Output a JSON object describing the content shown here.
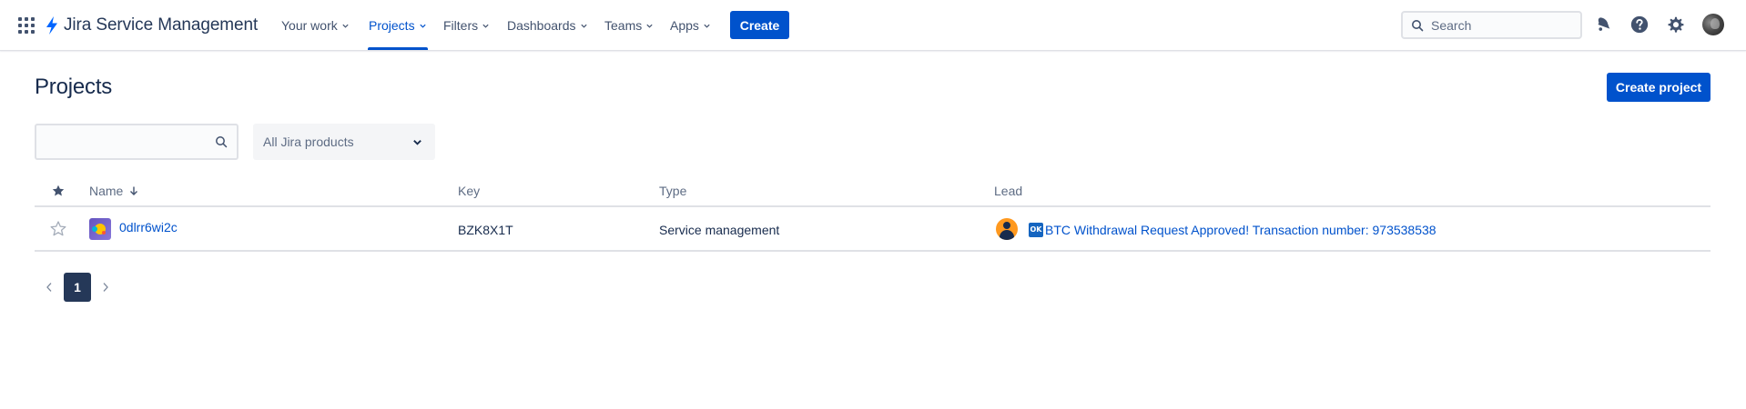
{
  "nav": {
    "brand": "Jira Service Management",
    "items": [
      {
        "label": "Your work"
      },
      {
        "label": "Projects"
      },
      {
        "label": "Filters"
      },
      {
        "label": "Dashboards"
      },
      {
        "label": "Teams"
      },
      {
        "label": "Apps"
      }
    ],
    "active_item": "Projects",
    "create_label": "Create",
    "search_placeholder": "Search",
    "icons": [
      "app-switcher-icon",
      "notifications-icon",
      "help-icon",
      "settings-icon",
      "profile-avatar"
    ],
    "accent_color": "#0052cc"
  },
  "page": {
    "title": "Projects",
    "create_project_label": "Create project"
  },
  "filters": {
    "search_value": "",
    "product_select": "All Jira products"
  },
  "table": {
    "columns": {
      "star": "star-icon",
      "name": "Name",
      "key": "Key",
      "type": "Type",
      "lead": "Lead"
    },
    "sort": {
      "column": "Name",
      "direction": "descending-arrow"
    },
    "rows": [
      {
        "name": "0dlrr6wi2c",
        "key": "BZK8X1T",
        "type": "Service management",
        "lead_badge": "OK",
        "lead": "BTC Withdrawal Request Approved! Transaction number: 973538538",
        "starred": false
      }
    ]
  },
  "pagination": {
    "current_page": "1",
    "prev_icon": "chevron-left-icon",
    "next_icon": "chevron-right-icon"
  }
}
